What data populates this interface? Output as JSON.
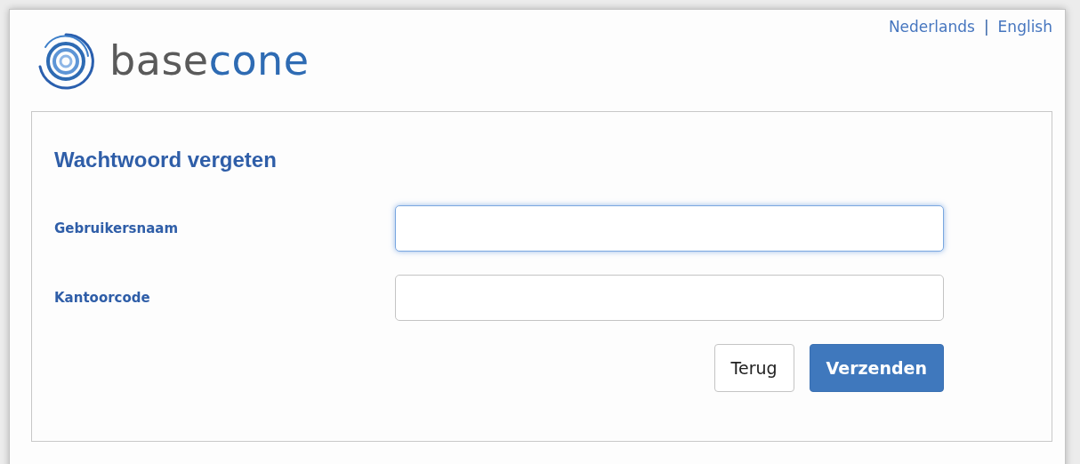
{
  "logo": {
    "text_dark": "base",
    "text_blue": "cone"
  },
  "languages": [
    {
      "label": "Nederlands"
    },
    {
      "label": "English"
    }
  ],
  "language_separator": "|",
  "form": {
    "title": "Wachtwoord vergeten",
    "fields": [
      {
        "label": "Gebruikersnaam",
        "focused": true
      },
      {
        "label": "Kantoorcode",
        "focused": false
      }
    ],
    "buttons": [
      {
        "label": "Terug",
        "kind": "secondary"
      },
      {
        "label": "Verzenden",
        "kind": "primary"
      }
    ]
  }
}
